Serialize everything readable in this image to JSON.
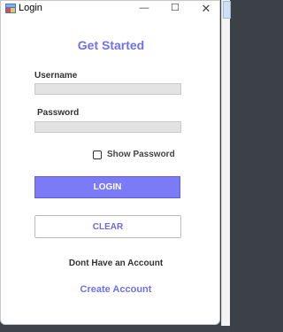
{
  "window": {
    "title": "Login",
    "minimize_glyph": "—",
    "maximize_glyph": "☐",
    "close_glyph": "✕"
  },
  "form": {
    "heading": "Get Started",
    "username_label": "Username",
    "username_value": "",
    "password_label": "Password",
    "password_value": "",
    "show_password_label": "Show Password",
    "show_password_checked": false,
    "login_button": "LOGIN",
    "clear_button": "CLEAR",
    "no_account_text": "Dont Have an Account",
    "create_account_link": "Create Account"
  },
  "colors": {
    "accent": "#7b7bf8",
    "heading": "#7070f0",
    "field_bg": "#e3e3e3"
  }
}
